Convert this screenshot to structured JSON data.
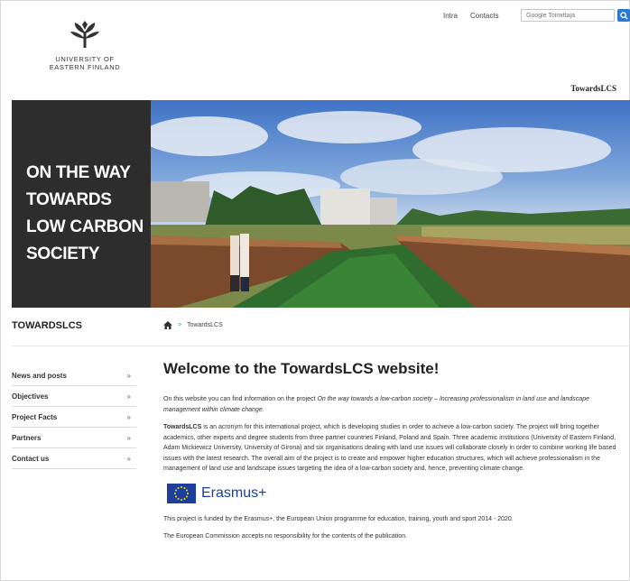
{
  "header": {
    "logo_line1": "UNIVERSITY OF",
    "logo_line2": "EASTERN FINLAND",
    "top_links": [
      "Intra",
      "Contacts"
    ],
    "search_placeholder": "Google Toimittaja",
    "site_name": "TowardsLCS"
  },
  "hero": {
    "title_line1": "ON THE WAY",
    "title_line2": "TOWARDS",
    "title_line3": "LOW CARBON",
    "title_line4": "SOCIETY"
  },
  "section": {
    "label": "TOWARDSLCS",
    "breadcrumb_current": "TowardsLCS"
  },
  "sidebar": {
    "items": [
      {
        "label": "News and posts",
        "arrow": "»"
      },
      {
        "label": "Objectives",
        "arrow": "»"
      },
      {
        "label": "Project Facts",
        "arrow": "»"
      },
      {
        "label": "Partners",
        "arrow": "»"
      },
      {
        "label": "Contact us",
        "arrow": "»"
      }
    ]
  },
  "main": {
    "heading": "Welcome to the TowardsLCS website!",
    "intro_prefix": "On this website you can find information on the project ",
    "intro_italic": "On the way towards a low-carbon society – Increasing professionalism in land use and landscape management within climate change.",
    "body_bold": "TowardsLCS",
    "body_text": " is an acronym for this international project, which is developing studies in order to achieve a low-carbon society. The project will bring together academics, other experts and degree students from three partner countries Finland, Poland and Spain. Three academic institutions (University of Eastern Finland, Adam Mickiewicz University, University of Girona) and six organisations dealing with land use issues will collaborate closely in order to combine working life based issues with the latest research. The overall aim of the project is to create and empower higher education structures, which will achieve professionalism in the management of land use and landscape issues targeting the idea of a low-carbon society and, hence, preventing climate change.",
    "erasmus_label": "Erasmus+",
    "funding_text": "This project is funded by the Erasmus+, the European Union programme for education, training, youth and sport 2014 - 2020.",
    "disclaimer_text": "The European Commission accepts no responsibility for the contents of the publication."
  },
  "colors": {
    "hero_dark": "#2d2d2d",
    "search_button": "#2979d4",
    "eu_blue": "#1b3f9a",
    "breadcrumb_separator": "#2a9d5b"
  }
}
